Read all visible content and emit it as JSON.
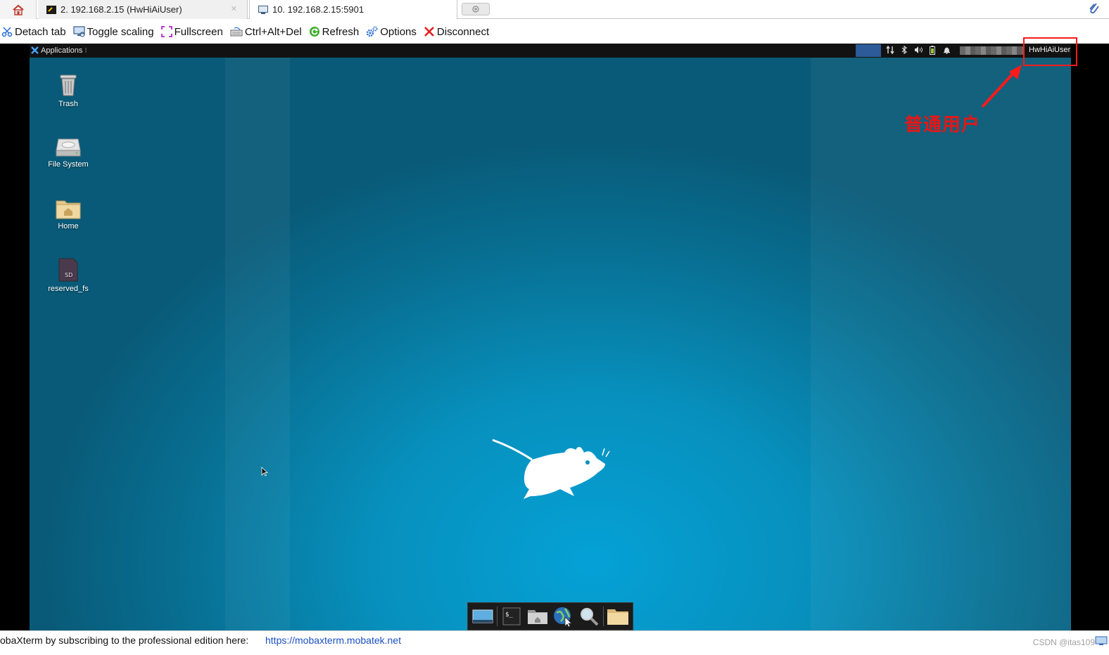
{
  "colors": {
    "accent_red": "#ff1a1a",
    "annotation_text": "#e71616",
    "desktop": "#0790bd",
    "link": "#1a4fc4"
  },
  "tabs": {
    "home_icon": "home-icon",
    "items": [
      {
        "label": "2. 192.168.2.15 (HwHiAiUser)",
        "icon": "terminal-icon",
        "active": false
      },
      {
        "label": "10. 192.168.2.15:5901",
        "icon": "vnc-icon",
        "active": true
      }
    ],
    "new_tab_icon": "plus-icon"
  },
  "toolbar": {
    "items": [
      {
        "label": "Detach tab",
        "icon": "scissors-icon"
      },
      {
        "label": "Toggle scaling",
        "icon": "monitor-icon"
      },
      {
        "label": "Fullscreen",
        "icon": "fullscreen-icon"
      },
      {
        "label": "Ctrl+Alt+Del",
        "icon": "keyboard-icon"
      },
      {
        "label": "Refresh",
        "icon": "refresh-icon"
      },
      {
        "label": "Options",
        "icon": "gear-icon"
      },
      {
        "label": "Disconnect",
        "icon": "close-icon"
      }
    ]
  },
  "panel": {
    "applications_label": "Applications",
    "user_label": "HwHiAiUser"
  },
  "desktop": {
    "icons": [
      {
        "label": "Trash",
        "icon": "trash-icon"
      },
      {
        "label": "File System",
        "icon": "drive-icon"
      },
      {
        "label": "Home",
        "icon": "home-folder-icon"
      },
      {
        "label": "reserved_fs",
        "icon": "sd-card-icon"
      }
    ]
  },
  "dock": {
    "items": [
      {
        "icon": "show-desktop-icon"
      },
      {
        "icon": "terminal-icon"
      },
      {
        "icon": "file-manager-icon"
      },
      {
        "icon": "web-browser-icon"
      },
      {
        "icon": "app-finder-icon"
      },
      {
        "icon": "folder-icon"
      }
    ]
  },
  "annotation": {
    "text": "普通用户"
  },
  "banner": {
    "text": "obaXterm by subscribing to the professional edition here:",
    "link": "https://mobaxterm.mobatek.net",
    "watermark": "CSDN @itas109"
  }
}
